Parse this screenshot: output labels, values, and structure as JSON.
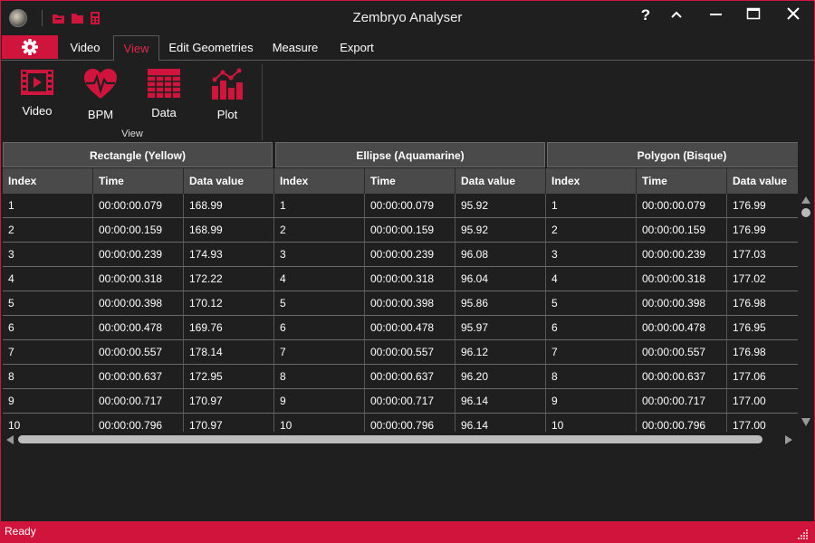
{
  "window": {
    "title": "Zembryo Analyser"
  },
  "titlebar": {
    "help_label": "?"
  },
  "tabs": {
    "video": "Video",
    "view": "View",
    "edit_geometries": "Edit Geometries",
    "measure": "Measure",
    "export": "Export"
  },
  "ribbon": {
    "group_label": "View",
    "buttons": {
      "video": "Video",
      "bpm": "BPM",
      "data": "Data",
      "plot": "Plot"
    }
  },
  "grid": {
    "groups": [
      "Rectangle (Yellow)",
      "Ellipse (Aquamarine)",
      "Polygon (Bisque)"
    ],
    "columns": [
      "Index",
      "Time",
      "Data value"
    ],
    "rows": [
      [
        "1",
        "00:00:00.079",
        "168.99",
        "1",
        "00:00:00.079",
        "95.92",
        "1",
        "00:00:00.079",
        "176.99"
      ],
      [
        "2",
        "00:00:00.159",
        "168.99",
        "2",
        "00:00:00.159",
        "95.92",
        "2",
        "00:00:00.159",
        "176.99"
      ],
      [
        "3",
        "00:00:00.239",
        "174.93",
        "3",
        "00:00:00.239",
        "96.08",
        "3",
        "00:00:00.239",
        "177.03"
      ],
      [
        "4",
        "00:00:00.318",
        "172.22",
        "4",
        "00:00:00.318",
        "96.04",
        "4",
        "00:00:00.318",
        "177.02"
      ],
      [
        "5",
        "00:00:00.398",
        "170.12",
        "5",
        "00:00:00.398",
        "95.86",
        "5",
        "00:00:00.398",
        "176.98"
      ],
      [
        "6",
        "00:00:00.478",
        "169.76",
        "6",
        "00:00:00.478",
        "95.97",
        "6",
        "00:00:00.478",
        "176.95"
      ],
      [
        "7",
        "00:00:00.557",
        "178.14",
        "7",
        "00:00:00.557",
        "96.12",
        "7",
        "00:00:00.557",
        "176.98"
      ],
      [
        "8",
        "00:00:00.637",
        "172.95",
        "8",
        "00:00:00.637",
        "96.20",
        "8",
        "00:00:00.637",
        "177.06"
      ],
      [
        "9",
        "00:00:00.717",
        "170.97",
        "9",
        "00:00:00.717",
        "96.14",
        "9",
        "00:00:00.717",
        "177.00"
      ],
      [
        "10",
        "00:00:00.796",
        "170.97",
        "10",
        "00:00:00.796",
        "96.14",
        "10",
        "00:00:00.796",
        "177.00"
      ]
    ]
  },
  "status": {
    "text": "Ready"
  },
  "colors": {
    "accent": "#d1143c",
    "background": "#1f1f1f",
    "header": "#4a4a4a"
  }
}
